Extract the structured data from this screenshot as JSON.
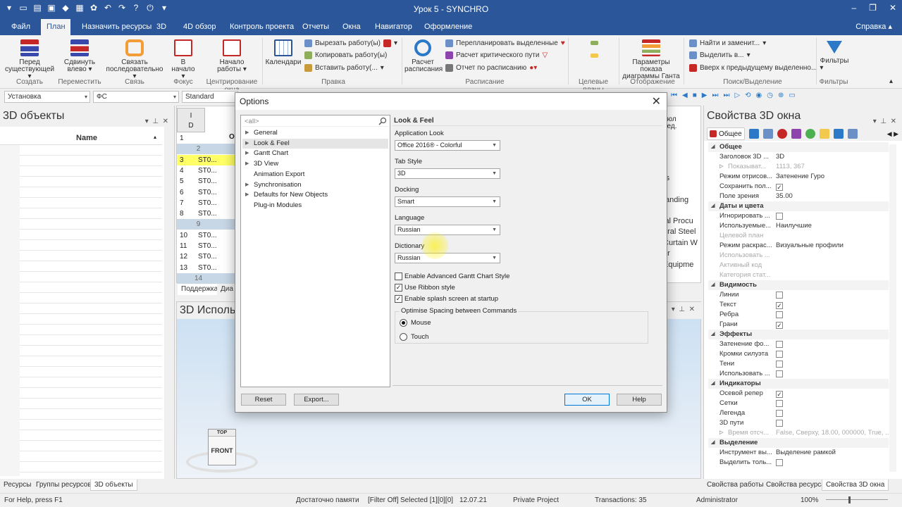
{
  "window": {
    "title": "Урок 5 - SYNCHRO"
  },
  "menu": {
    "tabs": [
      "Файл",
      "План",
      "Назначить ресурсы",
      "3D",
      "4D обзор",
      "Контроль проекта",
      "Отчеты",
      "Окна",
      "Навигатор",
      "Оформление"
    ],
    "help": "Справка"
  },
  "ribbon": {
    "btn_before_existing": "Перед существующей",
    "btn_shift_left": "Сдвинуть влево",
    "btn_link_sequential": "Связать последовательно",
    "btn_to_start": "В начало",
    "btn_work_start": "Начало работы",
    "btn_calendars": "Календари",
    "cut_work": "Вырезать работу(ы)",
    "copy_work": "Копировать работу(ы)",
    "paste_work": "Вставить работу(...",
    "btn_calc_schedule": "Расчет расписания",
    "replan_selected": "Перепланировать выделенные",
    "critical_path": "Расчет критического пути",
    "schedule_report": "Отчет по расписанию",
    "gantt_params": "Параметры показа диаграммы Ганта",
    "find_replace": "Найти и заменит...",
    "select_in": "Выделить в...",
    "up_to_prev": "Вверх к предыдущему выделенно...",
    "btn_filters": "Фильтры",
    "groups": {
      "create": "Создать",
      "move": "Переместить",
      "link": "Связь",
      "focus": "Фокус",
      "center": "Центрирование окна",
      "edit": "Правка",
      "schedule": "Расписание",
      "targets": "Целевые планы",
      "display": "Отображение",
      "search": "Поиск/Выделение",
      "filters": "Фильтры"
    }
  },
  "filterbar": {
    "combo1": "Установка",
    "combo2": "ФС",
    "combo3": "Standard"
  },
  "left_panel": {
    "title": "3D объекты",
    "col_name": "Name"
  },
  "left_tabs": [
    "Ресурсы",
    "Группы ресурсов",
    "3D объекты"
  ],
  "gantt": {
    "id_header": "I\nD",
    "col_o": "О",
    "rows": [
      {
        "num": "1",
        "txt": ""
      },
      {
        "num": "2",
        "txt": ""
      },
      {
        "num": "3",
        "txt": "ST0..."
      },
      {
        "num": "4",
        "txt": "ST0..."
      },
      {
        "num": "5",
        "txt": "ST0..."
      },
      {
        "num": "6",
        "txt": "ST0..."
      },
      {
        "num": "7",
        "txt": "ST0..."
      },
      {
        "num": "8",
        "txt": "ST0..."
      },
      {
        "num": "9",
        "txt": ""
      },
      {
        "num": "10",
        "txt": "ST0..."
      },
      {
        "num": "11",
        "txt": "ST0..."
      },
      {
        "num": "12",
        "txt": "ST0..."
      },
      {
        "num": "13",
        "txt": "ST0..."
      },
      {
        "num": "14",
        "txt": ""
      }
    ],
    "right_labels": [
      "июл",
      "нед.",
      "rs",
      "tanding",
      "ial Procu",
      "ural Steel",
      "Curtain W",
      "or",
      "Equipme"
    ],
    "tabs": [
      "Поддержка",
      "Диа"
    ]
  },
  "viewport": {
    "title": "3D Использ",
    "cube_top": "TOP",
    "cube_front": "FRONT"
  },
  "right_panel": {
    "title": "Свойства 3D окна",
    "tab_general": "Общее",
    "props": [
      {
        "type": "cat",
        "k": "Общее"
      },
      {
        "k": "Заголовок 3D ...",
        "v": "3D"
      },
      {
        "k": "Показыват...",
        "v": "1113, 367",
        "dis": true,
        "sub": true
      },
      {
        "k": "Режим отрисов...",
        "v": "Затенение Гуро"
      },
      {
        "k": "Сохранить пол...",
        "chk": true
      },
      {
        "k": "Поле зрения",
        "v": "35.00"
      },
      {
        "type": "cat",
        "k": "Даты и цвета"
      },
      {
        "k": "Игнорировать ...",
        "chk": false
      },
      {
        "k": "Используемые...",
        "v": "Наилучшие"
      },
      {
        "k": "Целевой план",
        "dis": true
      },
      {
        "k": "Режим раскрас...",
        "v": "Визуальные профили"
      },
      {
        "k": "Использовать ...",
        "dis": true
      },
      {
        "k": "Активный код",
        "dis": true
      },
      {
        "k": "Категория стат...",
        "dis": true
      },
      {
        "type": "cat",
        "k": "Видимость"
      },
      {
        "k": "Линии",
        "chk": false
      },
      {
        "k": "Текст",
        "chk": true
      },
      {
        "k": "Ребра",
        "chk": false
      },
      {
        "k": "Грани",
        "chk": true
      },
      {
        "type": "cat",
        "k": "Эффекты"
      },
      {
        "k": "Затенение фо...",
        "chk": false
      },
      {
        "k": "Кромки силуэта",
        "chk": false
      },
      {
        "k": "Тени",
        "chk": false
      },
      {
        "k": "Использовать ...",
        "chk": false
      },
      {
        "type": "cat",
        "k": "Индикаторы"
      },
      {
        "k": "Осевой репер",
        "chk": true
      },
      {
        "k": "Сетки",
        "chk": false
      },
      {
        "k": "Легенда",
        "chk": false
      },
      {
        "k": "3D пути",
        "chk": false
      },
      {
        "k": "Время отсч...",
        "v": "False, Сверху, 18.00, 000000, True, ...",
        "dis": true,
        "sub": true
      },
      {
        "type": "cat",
        "k": "Выделение"
      },
      {
        "k": "Инструмент вы...",
        "v": "Выделение рамкой"
      },
      {
        "k": "Выделить толь...",
        "chk": false
      }
    ]
  },
  "right_tabs": [
    "Свойства работы",
    "Свойства ресурса",
    "Свойства 3D окна"
  ],
  "status": {
    "help": "For Help, press F1",
    "memory": "Достаточно памяти",
    "filter": "[Filter Off]",
    "selected": "Selected [1][0][0]",
    "date": "12.07.21",
    "project": "Private Project",
    "transactions": "Transactions: 35",
    "user": "Administrator",
    "zoom": "100%"
  },
  "dialog": {
    "title": "Options",
    "search_placeholder": "<all>",
    "tree": [
      {
        "label": "General",
        "arrow": true
      },
      {
        "label": "Look & Feel",
        "arrow": true,
        "sel": true
      },
      {
        "label": "Gantt Chart",
        "arrow": true
      },
      {
        "label": "3D View",
        "arrow": true
      },
      {
        "label": "Animation Export",
        "arrow": false
      },
      {
        "label": "Synchronisation",
        "arrow": true
      },
      {
        "label": "Defaults for New Objects",
        "arrow": true
      },
      {
        "label": "Plug-in Modules",
        "arrow": false
      }
    ],
    "section_title": "Look & Feel",
    "app_look_label": "Application Look",
    "app_look_value": "Office 2016® - Colorful",
    "tab_style_label": "Tab Style",
    "tab_style_value": "3D",
    "docking_label": "Docking",
    "docking_value": "Smart",
    "language_label": "Language",
    "language_value": "Russian",
    "dictionary_label": "Dictionary",
    "dictionary_value": "Russian",
    "cb_advanced_gantt": "Enable Advanced Gantt Chart Style",
    "cb_ribbon": "Use Ribbon style",
    "cb_splash": "Enable splash screen at startup",
    "spacing_group": "Optimise Spacing between Commands",
    "radio_mouse": "Mouse",
    "radio_touch": "Touch",
    "btn_reset": "Reset",
    "btn_export": "Export...",
    "btn_ok": "OK",
    "btn_help": "Help"
  }
}
